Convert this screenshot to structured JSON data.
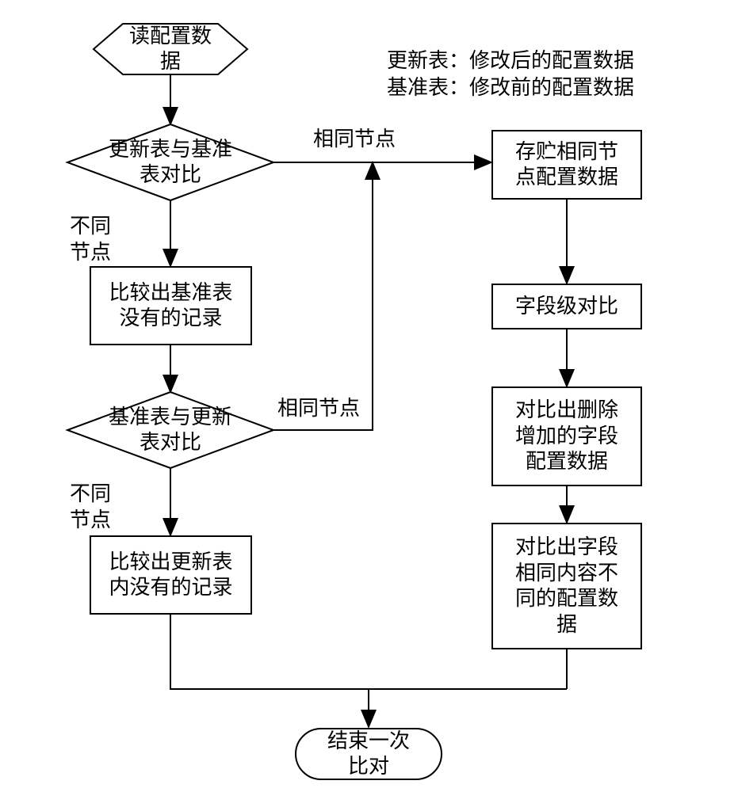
{
  "legend": {
    "line1_label": "更新表：",
    "line1_value": "修改后的配置数据",
    "line2_label": "基准表：",
    "line2_value": "修改前的配置数据"
  },
  "nodes": {
    "start": "读配置数\n据",
    "decision1": "更新表与基准\n表对比",
    "left1": "比较出基准表\n没有的记录",
    "decision2": "基准表与更新\n表对比",
    "left2": "比较出更新表\n内没有的记录",
    "right1": "存贮相同节\n点配置数据",
    "right2": "字段级对比",
    "right3": "对比出删除\n增加的字段\n配置数据",
    "right4": "对比出字段\n相同内容不\n同的配置数\n据",
    "end": "结束一次\n比对"
  },
  "edges": {
    "same_node": "相同节点",
    "diff_node": "不同\n节点"
  }
}
